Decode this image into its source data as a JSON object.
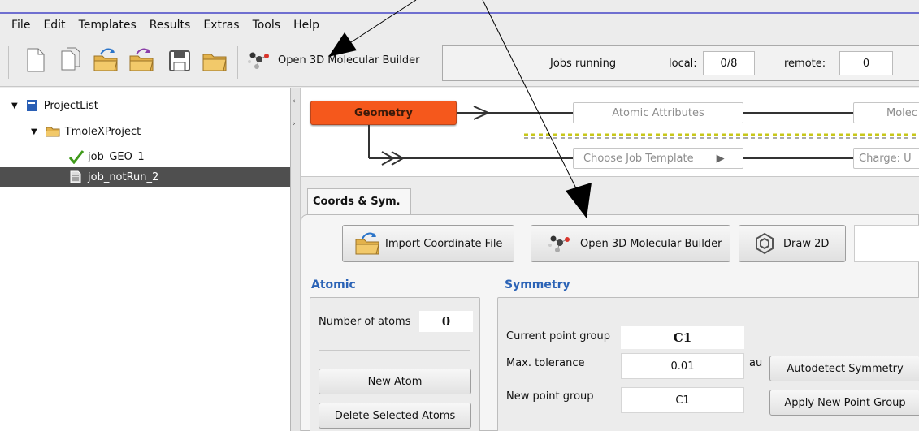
{
  "menu": [
    "File",
    "Edit",
    "Templates",
    "Results",
    "Extras",
    "Tools",
    "Help"
  ],
  "toolbar": {
    "icons": [
      "new-file-icon",
      "copy-file-icon",
      "open-project-icon",
      "open-project-recent-icon",
      "save-icon",
      "folder-icon"
    ],
    "molecular_builder_label": "Open 3D Molecular Builder",
    "jobs_running_label": "Jobs running",
    "local_label": "local:",
    "local_value": "0/8",
    "remote_label": "remote:",
    "remote_value": "0"
  },
  "tree": {
    "root": "ProjectList",
    "project": "TmoleXProject",
    "job1": "job_GEO_1",
    "job2": "job_notRun_2"
  },
  "workflow": {
    "geometry": "Geometry",
    "atomic_attributes": "Atomic Attributes",
    "molec": "Molec",
    "choose_template": "Choose Job Template",
    "charge": "Charge: U"
  },
  "tabs": {
    "coords": "Coords & Sym."
  },
  "buttons": {
    "import_coords": "Import Coordinate File",
    "open_builder": "Open 3D Molecular Builder",
    "draw2d": "Draw 2D"
  },
  "atomic": {
    "title": "Atomic",
    "num_atoms_label": "Number of atoms",
    "num_atoms_value": "0",
    "new_atom": "New Atom",
    "delete_atoms": "Delete Selected Atoms"
  },
  "symmetry": {
    "title": "Symmetry",
    "current_pg_label": "Current point group",
    "current_pg_value": "C1",
    "tolerance_label": "Max. tolerance",
    "tolerance_value": "0.01",
    "tolerance_unit": "au",
    "autodetect": "Autodetect Symmetry",
    "new_pg_label": "New point group",
    "new_pg_value": "C1",
    "apply": "Apply New Point Group"
  }
}
